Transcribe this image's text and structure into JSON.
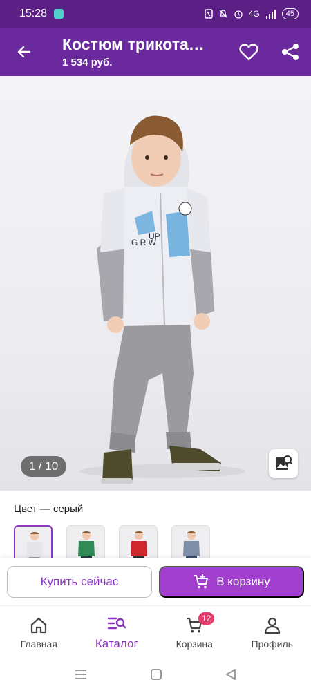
{
  "status_bar": {
    "time": "15:28",
    "network": "4G",
    "battery": "45"
  },
  "app_bar": {
    "title": "Костюм трикота…",
    "price": "1 534 руб."
  },
  "gallery": {
    "counter": "1 / 10"
  },
  "color_section": {
    "label": "Цвет — серый",
    "swatches": [
      "grey",
      "green",
      "red",
      "navy"
    ],
    "selected_index": 0
  },
  "actions": {
    "buy_now": "Купить сейчас",
    "add_to_cart": "В корзину"
  },
  "bottom_nav": {
    "items": [
      {
        "label": "Главная",
        "icon": "home-icon"
      },
      {
        "label": "Каталог",
        "icon": "catalog-search-icon",
        "active": true
      },
      {
        "label": "Корзина",
        "icon": "cart-icon",
        "badge": "12"
      },
      {
        "label": "Профиль",
        "icon": "profile-icon"
      }
    ]
  },
  "colors": {
    "status_bar": "#5b1f86",
    "app_bar": "#6a2a9d",
    "accent": "#8e36c4",
    "cart_button": "#a23fcf",
    "badge": "#e53a6b"
  }
}
